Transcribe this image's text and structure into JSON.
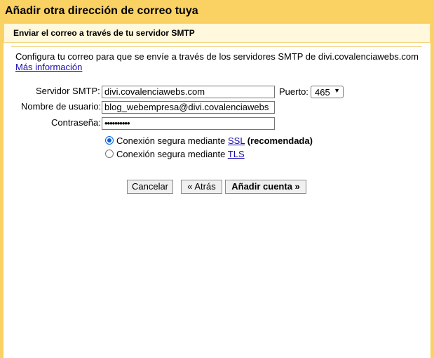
{
  "dialog": {
    "title": "Añadir otra dirección de correo tuya",
    "subtitle": "Enviar el correo a través de tu servidor SMTP",
    "description": "Configura tu correo para que se envíe a través de los servidores SMTP de divi.covalenciawebs.com",
    "more_info_link": "Más información"
  },
  "form": {
    "smtp_label": "Servidor SMTP:",
    "smtp_value": "divi.covalenciawebs.com",
    "port_label": "Puerto:",
    "port_value": "465",
    "username_label": "Nombre de usuario:",
    "username_value": "blog_webempresa@divi.covalenciawebs",
    "password_label": "Contraseña:",
    "password_value": "••••••••••",
    "ssl_option": {
      "prefix": "Conexión segura mediante",
      "link": "SSL",
      "suffix": "(recomendada)",
      "selected": true
    },
    "tls_option": {
      "prefix": "Conexión segura mediante",
      "link": "TLS",
      "selected": false
    }
  },
  "buttons": {
    "cancel": "Cancelar",
    "back": "« Atrás",
    "add": "Añadir cuenta »"
  },
  "colors": {
    "header_bg": "#fad163",
    "subheader_bg": "#fff8dc",
    "link": "#1a0dab",
    "radio_accent": "#0060df"
  }
}
